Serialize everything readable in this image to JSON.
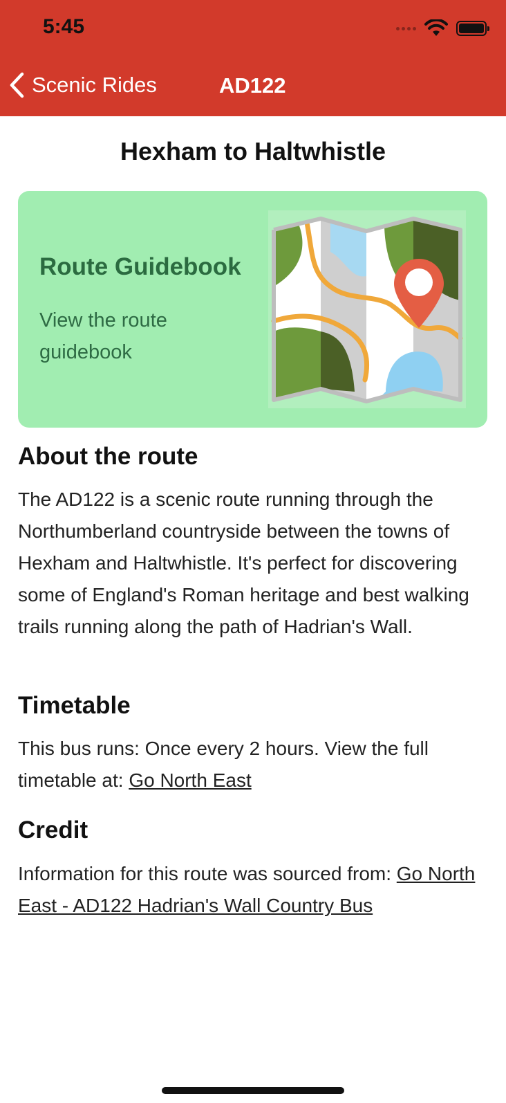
{
  "status": {
    "time": "5:45"
  },
  "nav": {
    "back_label": "Scenic Rides",
    "title": "AD122"
  },
  "page": {
    "title": "Hexham to Haltwhistle"
  },
  "guide_card": {
    "title": "Route Guidebook",
    "subtitle": "View the route guidebook"
  },
  "about": {
    "heading": "About the route",
    "body": "The AD122 is a scenic route running through the Northumberland countryside between the towns of Hexham and Haltwhistle. It's perfect for discovering some of England's Roman heritage and best walking trails running along the path of Hadrian's Wall."
  },
  "timetable": {
    "heading": "Timetable",
    "text": "This bus runs: Once every 2 hours. View the full timetable at: ",
    "link": "Go North East"
  },
  "credit": {
    "heading": "Credit",
    "text": "Information for this route was sourced from: ",
    "link": "Go North East - AD122 Hadrian's Wall Country Bus"
  },
  "colors": {
    "header": "#D23A2B",
    "card_bg": "#A1EDB1",
    "card_text": "#2B6B40"
  }
}
